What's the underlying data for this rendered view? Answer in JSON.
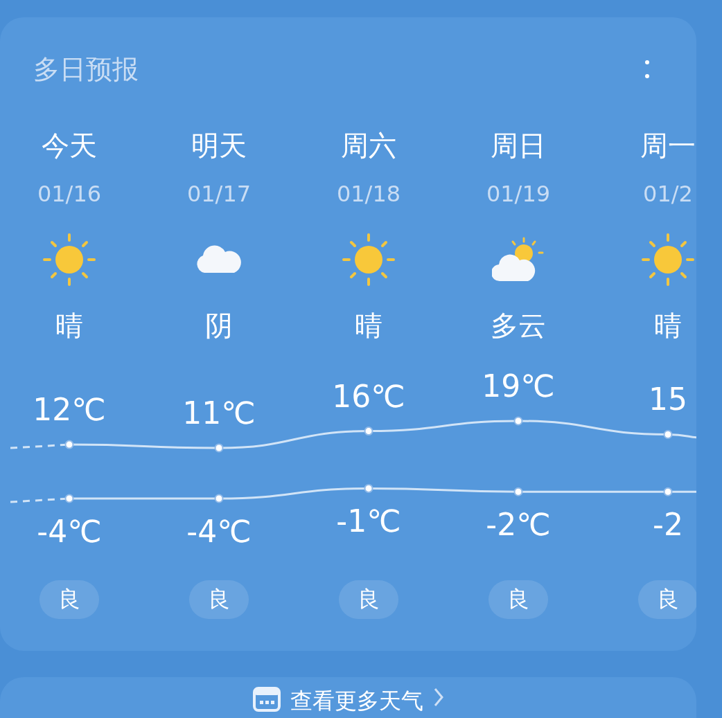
{
  "card": {
    "title": "多日预报"
  },
  "days": [
    {
      "name": "今天",
      "date": "01/16",
      "kind": "sunny",
      "condition": "晴",
      "high": "12℃",
      "low": "-4℃",
      "aqi": "良"
    },
    {
      "name": "明天",
      "date": "01/17",
      "kind": "cloudy",
      "condition": "阴",
      "high": "11℃",
      "low": "-4℃",
      "aqi": "良"
    },
    {
      "name": "周六",
      "date": "01/18",
      "kind": "sunny",
      "condition": "晴",
      "high": "16℃",
      "low": "-1℃",
      "aqi": "良"
    },
    {
      "name": "周日",
      "date": "01/19",
      "kind": "partly_cloudy",
      "condition": "多云",
      "high": "19℃",
      "low": "-2℃",
      "aqi": "良"
    },
    {
      "name": "周一",
      "date": "01/2",
      "kind": "sunny",
      "condition": "晴",
      "high": "15",
      "low": "-2",
      "aqi": "良"
    }
  ],
  "more_button": {
    "label": "查看更多天气"
  }
}
